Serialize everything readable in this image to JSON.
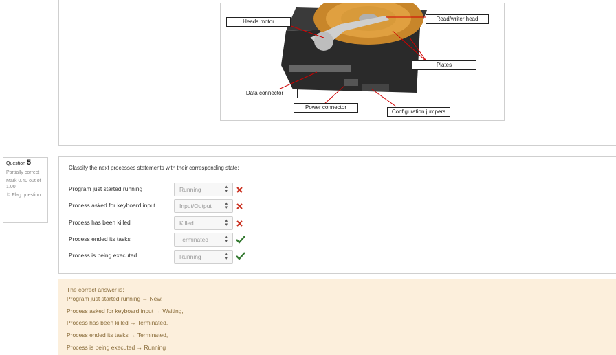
{
  "diagram": {
    "labels": {
      "heads_motor": "Heads motor",
      "read_writer_head": "Read/writer head",
      "plates": "Plates",
      "data_connector": "Data connector",
      "power_connector": "Power connector",
      "configuration_jumpers": "Configuration jumpers"
    }
  },
  "question_info": {
    "label": "Question",
    "number": "5",
    "state": "Partially correct",
    "mark": "Mark 0.40 out of 1.00",
    "flag": "Flag question"
  },
  "question": {
    "prompt": "Classify the next processes statements with their corresponding state:",
    "rows": [
      {
        "label": "Program just started running",
        "selected": "Running",
        "correct": false
      },
      {
        "label": "Process asked for keyboard input",
        "selected": "Input/Output",
        "correct": false
      },
      {
        "label": "Process has been killed",
        "selected": "Killed",
        "correct": false
      },
      {
        "label": "Process ended its tasks",
        "selected": "Terminated",
        "correct": true
      },
      {
        "label": "Process is being executed",
        "selected": "Running",
        "correct": true
      }
    ]
  },
  "feedback": {
    "intro": "The correct answer is:",
    "lines": [
      "Program just started running → New,",
      "Process asked for keyboard input → Waiting,",
      "Process has been killed → Terminated,",
      "Process ended its tasks → Terminated,",
      "Process is being executed → Running"
    ]
  },
  "colors": {
    "incorrect": "#ca3120",
    "correct": "#357a32",
    "feedback_bg": "#fcefdc",
    "feedback_text": "#8a6d3b"
  }
}
